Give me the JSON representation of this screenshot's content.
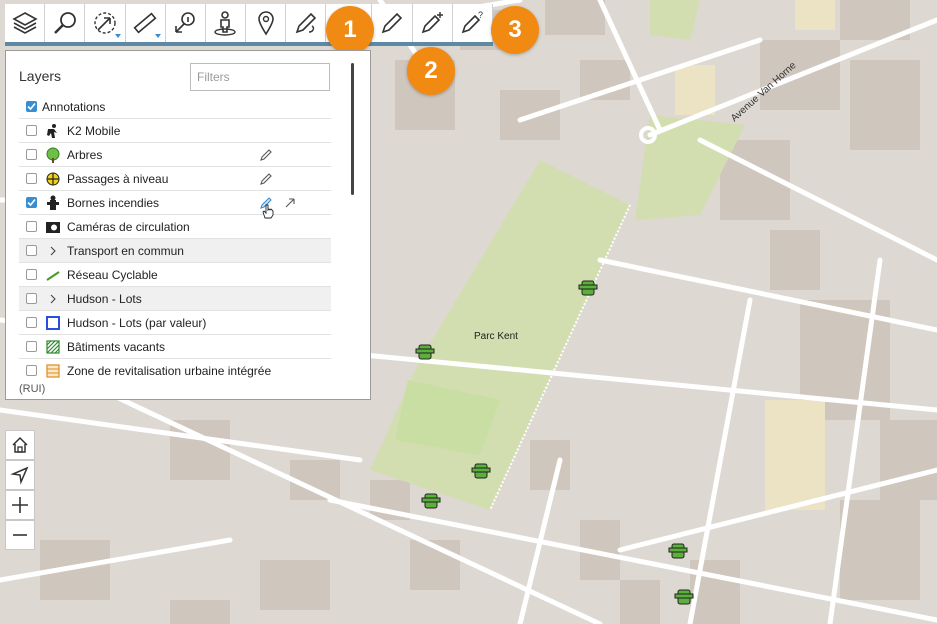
{
  "toolbar": {
    "tools": [
      {
        "name": "layers-icon"
      },
      {
        "name": "search-icon"
      },
      {
        "name": "select-icon"
      },
      {
        "name": "measure-icon"
      },
      {
        "name": "identify-icon"
      },
      {
        "name": "streetview-icon"
      },
      {
        "name": "location-icon"
      },
      {
        "name": "annotate-icon"
      },
      {
        "name": "edit-icon"
      },
      {
        "name": "add-feature-icon"
      },
      {
        "name": "edit-help-icon"
      }
    ],
    "accent": "#5c8aa6"
  },
  "callouts": [
    "1",
    "2",
    "3"
  ],
  "callout_color": "#f08a12",
  "layers_panel": {
    "title": "Layers",
    "filter_placeholder": "Filters",
    "layers": [
      {
        "label": "Annotations",
        "checked": true,
        "icon": "none"
      },
      {
        "label": "K2 Mobile",
        "checked": false,
        "icon": "k2-mobile-icon"
      },
      {
        "label": "Arbres",
        "checked": false,
        "icon": "tree-icon",
        "editable": true
      },
      {
        "label": "Passages à niveau",
        "checked": false,
        "icon": "crossing-icon",
        "editable": true
      },
      {
        "label": "Bornes incendies",
        "checked": true,
        "icon": "hydrant-icon",
        "editable": true,
        "selectable": true
      },
      {
        "label": "Caméras de circulation",
        "checked": false,
        "icon": "camera-icon"
      },
      {
        "label": "Transport en commun",
        "checked": false,
        "icon": "chevron-right-icon",
        "group": true
      },
      {
        "label": "Réseau Cyclable",
        "checked": false,
        "icon": "bike-line-icon"
      },
      {
        "label": "Hudson - Lots",
        "checked": false,
        "icon": "chevron-right-icon",
        "group": true
      },
      {
        "label": "Hudson - Lots (par valeur)",
        "checked": false,
        "icon": "blue-square-icon"
      },
      {
        "label": "Bâtiments vacants",
        "checked": false,
        "icon": "hatched-square-icon"
      },
      {
        "label": "Zone de revitalisation urbaine intégrée",
        "checked": false,
        "icon": "zone-icon"
      }
    ],
    "trailing_text": "(RUI)"
  },
  "map": {
    "park_label": "Parc Kent",
    "street_label": "Avenue Van Horne",
    "map_controls": [
      "home-icon",
      "navigate-icon",
      "zoom-in-icon",
      "zoom-out-icon"
    ]
  }
}
